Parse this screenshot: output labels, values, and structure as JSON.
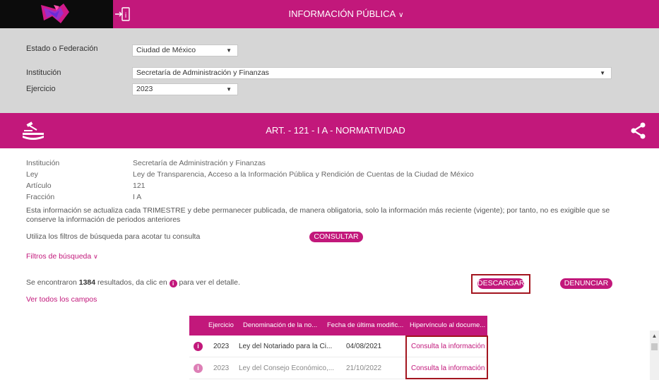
{
  "header": {
    "title": "INFORMACIÓN PÚBLICA",
    "logo_icon": "pnt-logo-icon",
    "home_icon": "exit-info-icon"
  },
  "filters": {
    "estado_label": "Estado o Federación",
    "estado_value": "Ciudad de México",
    "institucion_label": "Institución",
    "institucion_value": "Secretaría de Administración y Finanzas",
    "ejercicio_label": "Ejercicio",
    "ejercicio_value": "2023"
  },
  "section": {
    "title": "ART. - 121 - I A - NORMATIVIDAD",
    "icon": "law-gavel-icon",
    "share_icon": "share-icon"
  },
  "info": {
    "institucion_label": "Institución",
    "institucion_value": "Secretaría de Administración y Finanzas",
    "ley_label": "Ley",
    "ley_value": "Ley de Transparencia, Acceso a la Información Pública y Rendición de Cuentas de la Ciudad de México",
    "articulo_label": "Artículo",
    "articulo_value": "121",
    "fraccion_label": "Fracción",
    "fraccion_value": "I A",
    "notice": "Esta información se actualiza cada TRIMESTRE y debe permanecer publicada, de manera obligatoria, solo la información más reciente (vigente); por tanto, no es exigible que se conserve la información de periodos anteriores"
  },
  "search": {
    "use_filters_text": "Utiliza los filtros de búsqueda para acotar tu consulta",
    "consultar_label": "CONSULTAR",
    "filters_toggle": "Filtros de búsqueda"
  },
  "results": {
    "prefix": "Se encontraron",
    "count": "1384",
    "middle": "resultados, da clic en",
    "suffix": "para ver el detalle.",
    "descargar_label": "DESCARGAR",
    "denunciar_label": "DENUNCIAR",
    "ver_todos": "Ver todos los campos"
  },
  "table": {
    "columns": [
      "Ejercicio",
      "Denominación de la no...",
      "Fecha de última modific...",
      "Hipervínculo al docume..."
    ],
    "rows": [
      {
        "ejercicio": "2023",
        "denominacion": "Ley del Notariado para la Ci...",
        "fecha": "04/08/2021",
        "link": "Consulta la información"
      },
      {
        "ejercicio": "2023",
        "denominacion": "Ley del Consejo Económico,...",
        "fecha": "21/10/2022",
        "link": "Consulta la información"
      }
    ]
  },
  "colors": {
    "brand": "#c2187b",
    "panel": "#d6d6d6",
    "highlight": "#a3151f"
  }
}
